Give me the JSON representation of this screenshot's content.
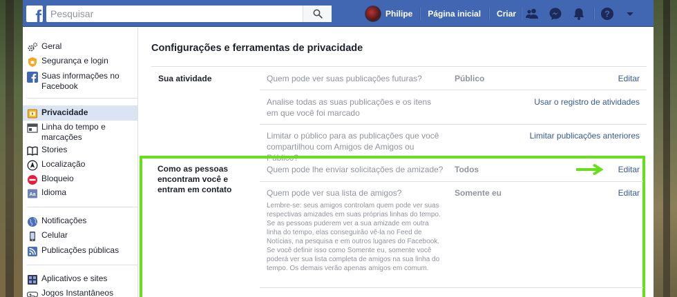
{
  "topbar": {
    "search_placeholder": "Pesquisar",
    "user_name": "Philipe",
    "home_label": "Página inicial",
    "create_label": "Criar",
    "icons": [
      "friends-icon",
      "messenger-icon",
      "notifications-icon",
      "help-icon",
      "account-menu-icon"
    ]
  },
  "sidebar": {
    "items": [
      {
        "label": "Geral",
        "icon": "gear-icon"
      },
      {
        "label": "Segurança e login",
        "icon": "shield-icon"
      },
      {
        "label": "Suas informações no Facebook",
        "icon": "facebook-icon"
      },
      {
        "label": "Privacidade",
        "icon": "lock-icon",
        "active": true
      },
      {
        "label": "Linha do tempo e marcações",
        "icon": "timeline-icon"
      },
      {
        "label": "Stories",
        "icon": "book-icon"
      },
      {
        "label": "Localização",
        "icon": "location-icon"
      },
      {
        "label": "Bloqueio",
        "icon": "block-icon"
      },
      {
        "label": "Idioma",
        "icon": "language-icon"
      },
      {
        "label": "Notificações",
        "icon": "globe-icon"
      },
      {
        "label": "Celular",
        "icon": "phone-icon"
      },
      {
        "label": "Publicações públicas",
        "icon": "rss-icon"
      },
      {
        "label": "Aplicativos e sites",
        "icon": "apps-icon"
      },
      {
        "label": "Jogos Instantâneos",
        "icon": "gamepad-icon"
      }
    ]
  },
  "main": {
    "title": "Configurações e ferramentas de privacidade",
    "sections": [
      {
        "title": "Sua atividade",
        "rows": [
          {
            "question": "Quem pode ver suas publicações futuras?",
            "value": "Público",
            "action": "Editar"
          },
          {
            "question": "Analise todas as suas publicações e os itens em que você foi marcado",
            "value": "",
            "action": "Usar o registro de atividades"
          },
          {
            "question": "Limitar o público para as publicações que você compartilhou com Amigos de Amigos ou Público?",
            "value": "",
            "action": "Limitar publicações anteriores"
          }
        ]
      },
      {
        "title": "Como as pessoas encontram você e entram em contato",
        "rows": [
          {
            "question": "Quem pode lhe enviar solicitações de amizade?",
            "value": "Todos",
            "action": "Editar"
          },
          {
            "question": "Quem pode ver sua lista de amigos?",
            "value": "Somente eu",
            "action": "Editar",
            "note": "Lembre-se: seus amigos controlam quem pode ver suas respectivas amizades em suas próprias linhas do tempo. Se as pessoas puderem ver a sua amizade em outra linha do tempo, elas conseguirão vê-la no Feed de Notícias, na pesquisa e em outros lugares do Facebook. Se você definir isso como Somente eu, somente você poderá ver sua lista completa de amigos na sua linha do tempo. Os demais verão apenas amigos em comum."
          }
        ]
      }
    ]
  },
  "colors": {
    "fb_blue": "#4267b2",
    "link": "#365899",
    "highlight_green": "#66e01d",
    "muted": "#90949c"
  }
}
